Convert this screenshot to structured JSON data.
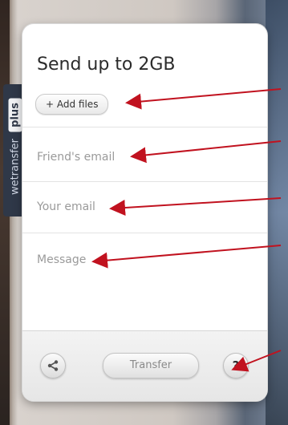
{
  "side_tab": {
    "label": "wetransfer",
    "badge": "plus"
  },
  "card": {
    "title": "Send up to 2GB",
    "add_files_label": "+ Add files",
    "friends_email_placeholder": "Friend's email",
    "your_email_placeholder": "Your email",
    "message_placeholder": "Message"
  },
  "footer": {
    "transfer_label": "Transfer",
    "help_label": "?"
  },
  "colors": {
    "annotation_red": "#c1121f",
    "card_bg": "#ffffff",
    "side_tab_bg": "#2f3848"
  },
  "icons": {
    "share": "share-icon",
    "help": "question-icon"
  }
}
